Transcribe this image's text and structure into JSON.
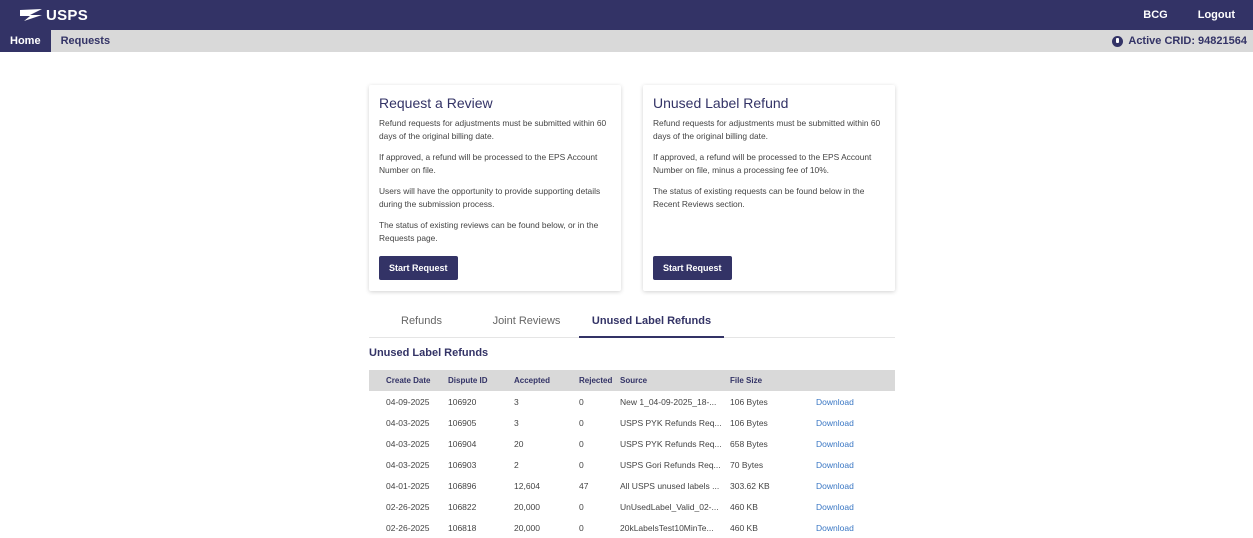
{
  "header": {
    "brand": "USPS",
    "user": "BCG",
    "logout": "Logout"
  },
  "nav": {
    "items": [
      {
        "label": "Home",
        "active": true
      },
      {
        "label": "Requests",
        "active": false
      }
    ],
    "crid": "Active CRID: 94821564"
  },
  "cards": [
    {
      "title": "Request a Review",
      "paragraphs": [
        "Refund requests for adjustments must be submitted within 60 days of the original billing date.",
        "If approved, a refund will be processed to the EPS Account Number on file.",
        "Users will have the opportunity to provide supporting details during the submission process.",
        "The status of existing reviews can be found below, or in the Requests page."
      ],
      "button": "Start Request"
    },
    {
      "title": "Unused Label Refund",
      "paragraphs": [
        "Refund requests for adjustments must be submitted within 60 days of the original billing date.",
        "If approved, a refund will be processed to the EPS Account Number on file, minus a processing fee of 10%.",
        "The status of existing requests can be found below in the Recent Reviews section."
      ],
      "button": "Start Request"
    }
  ],
  "tabs": [
    "Refunds",
    "Joint Reviews",
    "Unused Label Refunds"
  ],
  "active_tab": "Unused Label Refunds",
  "section_title": "Unused Label Refunds",
  "table": {
    "columns": [
      "Create Date",
      "Dispute ID",
      "Accepted",
      "Rejected",
      "Source",
      "File Size",
      ""
    ],
    "rows": [
      [
        "04-09-2025",
        "106920",
        "3",
        "0",
        "New 1_04-09-2025_18-...",
        "106 Bytes",
        "Download"
      ],
      [
        "04-03-2025",
        "106905",
        "3",
        "0",
        "USPS PYK Refunds Req...",
        "106 Bytes",
        "Download"
      ],
      [
        "04-03-2025",
        "106904",
        "20",
        "0",
        "USPS PYK Refunds Req...",
        "658 Bytes",
        "Download"
      ],
      [
        "04-03-2025",
        "106903",
        "2",
        "0",
        "USPS Gori Refunds Req...",
        "70 Bytes",
        "Download"
      ],
      [
        "04-01-2025",
        "106896",
        "12,604",
        "47",
        "All USPS unused labels ...",
        "303.62 KB",
        "Download"
      ],
      [
        "02-26-2025",
        "106822",
        "20,000",
        "0",
        "UnUsedLabel_Valid_02-...",
        "460 KB",
        "Download"
      ],
      [
        "02-26-2025",
        "106818",
        "20,000",
        "0",
        "20kLabelsTest10MinTe...",
        "460 KB",
        "Download"
      ]
    ]
  },
  "colors": {
    "primary": "#333366",
    "nav_bg": "#d9d9d9",
    "link": "#3a77c4"
  }
}
